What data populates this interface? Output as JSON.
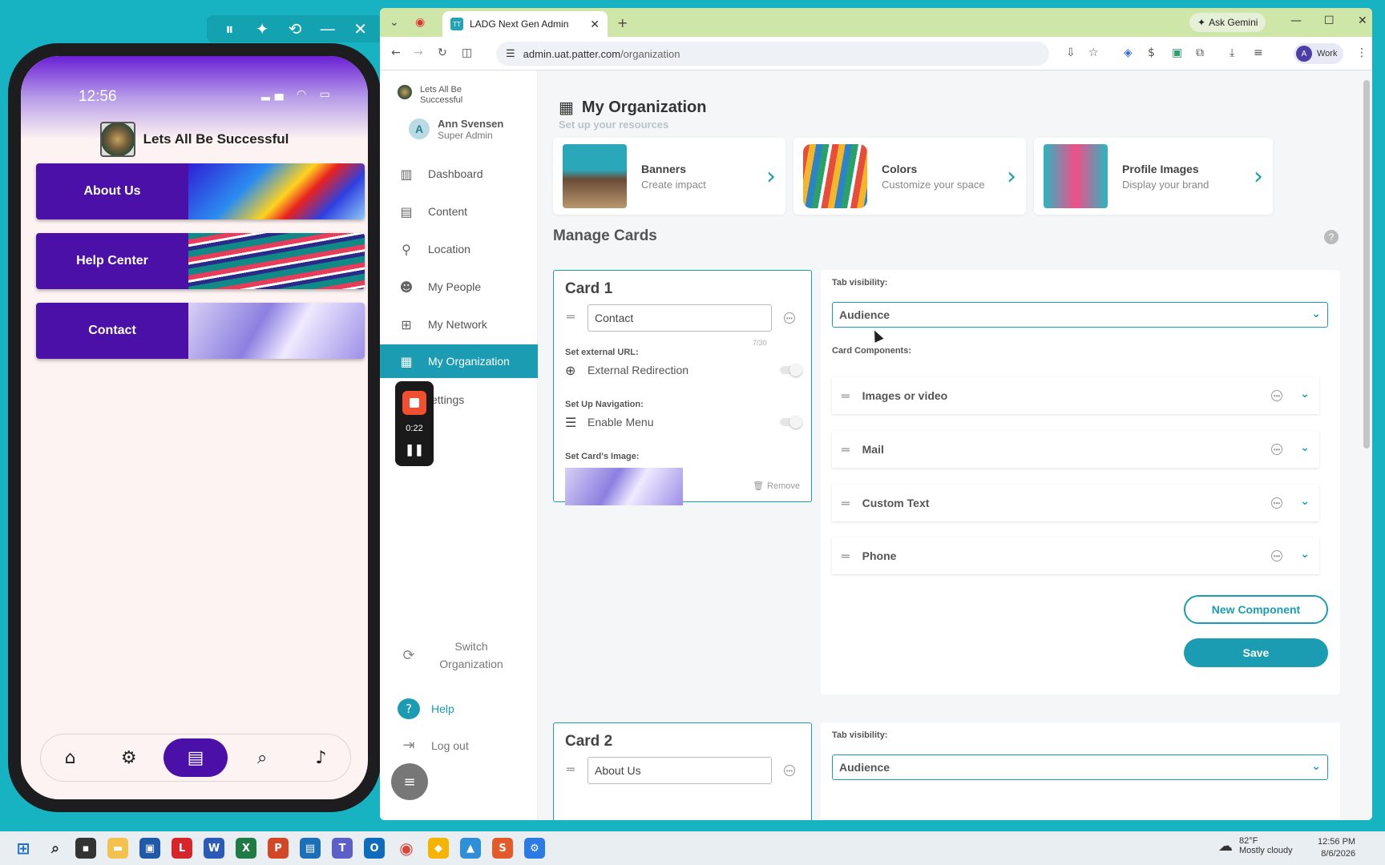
{
  "colors": {
    "accent": "#1b9cb3",
    "phone_brand": "#4a10a8",
    "tab_strip": "#cfe6a9",
    "desktop": "#17b3c2"
  },
  "phone": {
    "time": "12:56",
    "org_name": "Lets All Be Successful",
    "cards": [
      {
        "label": "About Us"
      },
      {
        "label": "Help Center"
      },
      {
        "label": "Contact"
      }
    ],
    "nav_icons": [
      "home-icon",
      "gear-icon",
      "book-icon",
      "search-icon",
      "bell-icon"
    ]
  },
  "browser": {
    "tab_title": "LADG Next Gen Admin",
    "tab_favicon": "TT",
    "ask_gemini": "Ask Gemini",
    "url_host": "admin.uat.patter.com",
    "url_path": "/organization",
    "profile_initial": "A",
    "profile_label": "Work"
  },
  "sidebar": {
    "org_name": "Lets All Be Successful",
    "user": {
      "initial": "A",
      "name": "Ann Svensen",
      "role": "Super Admin"
    },
    "items": [
      {
        "label": "Dashboard",
        "icon": "chart-icon"
      },
      {
        "label": "Content",
        "icon": "content-icon"
      },
      {
        "label": "Location",
        "icon": "pin-icon"
      },
      {
        "label": "My People",
        "icon": "people-icon"
      },
      {
        "label": "My Network",
        "icon": "network-icon"
      },
      {
        "label": "My Organization",
        "icon": "building-icon"
      },
      {
        "label": "ettings",
        "icon": "gear-icon"
      }
    ],
    "switch_org": "Switch Organization",
    "help": "Help",
    "logout": "Log out"
  },
  "recorder": {
    "time": "0:22"
  },
  "main": {
    "title": "My Organization",
    "subtitle": "Set up your resources",
    "resources": [
      {
        "title": "Banners",
        "subtitle": "Create impact"
      },
      {
        "title": "Colors",
        "subtitle": "Customize your space"
      },
      {
        "title": "Profile Images",
        "subtitle": "Display your brand"
      }
    ],
    "manage_cards_title": "Manage Cards",
    "card1": {
      "heading": "Card 1",
      "name_value": "Contact",
      "char_count": "7/30",
      "external_url_label": "Set external URL:",
      "external_redirection": "External Redirection",
      "navigation_label": "Set Up Navigation:",
      "enable_menu": "Enable Menu",
      "image_label": "Set Card's Image:",
      "remove": "Remove"
    },
    "card1_settings": {
      "tab_visibility_label": "Tab visibility:",
      "audience": "Audience",
      "components_label": "Card Components:",
      "components": [
        "Images or video",
        "Mail",
        "Custom Text",
        "Phone"
      ],
      "new_component": "New Component",
      "save": "Save"
    },
    "card2": {
      "heading": "Card 2",
      "name_value": "About Us"
    },
    "card2_settings": {
      "tab_visibility_label": "Tab visibility:",
      "audience": "Audience"
    }
  },
  "taskbar": {
    "weather_temp": "82°F",
    "weather_desc": "Mostly cloudy",
    "time": "12:56 PM",
    "date": "8/6/2026"
  }
}
